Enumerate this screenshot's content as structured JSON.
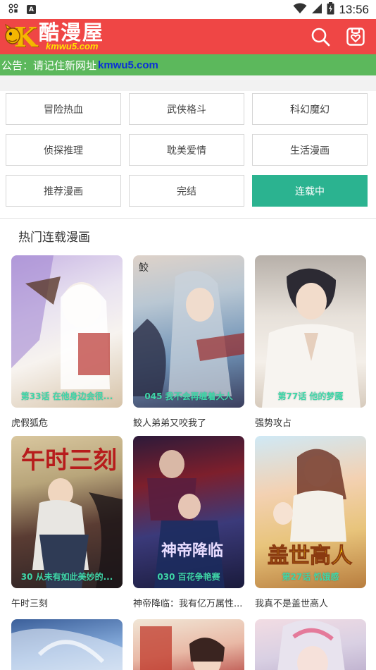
{
  "status_bar": {
    "time": "13:56"
  },
  "header": {
    "logo_mark": "K",
    "logo_text": "酷漫屋",
    "logo_url": "kmwu5.com",
    "search_icon": "search-icon",
    "bookmark_icon": "bookmark-heart-icon"
  },
  "notice": {
    "prefix": "公告：请记住新网址 ",
    "link": "kmwu5.com"
  },
  "categories": [
    {
      "label": "冒险热血",
      "active": false
    },
    {
      "label": "武侠格斗",
      "active": false
    },
    {
      "label": "科幻魔幻",
      "active": false
    },
    {
      "label": "侦探推理",
      "active": false
    },
    {
      "label": "耽美爱情",
      "active": false
    },
    {
      "label": "生活漫画",
      "active": false
    },
    {
      "label": "推荐漫画",
      "active": false
    },
    {
      "label": "完结",
      "active": false
    },
    {
      "label": "连载中",
      "active": true
    }
  ],
  "section": {
    "title": "热门连载漫画",
    "comics": [
      {
        "title": "虎假狐危",
        "episode": "第33话 在他身边会很..."
      },
      {
        "title": "鲛人弟弟又咬我了",
        "episode": "045 我不会再缠着大人"
      },
      {
        "title": "强势攻占",
        "episode": "第77话 他的梦魇"
      },
      {
        "title": "午时三刻",
        "episode": "30 从未有如此美妙的..."
      },
      {
        "title": "神帝降临：我有亿万属性...",
        "episode": "030 百花争艳赛"
      },
      {
        "title": "我真不是盖世高人",
        "episode": "第27话 饥饿感"
      },
      {
        "title": "",
        "episode": ""
      },
      {
        "title": "",
        "episode": ""
      },
      {
        "title": "",
        "episode": ""
      }
    ]
  },
  "colors": {
    "header": "#ef4645",
    "notice": "#5cb85c",
    "accent": "#2bb390",
    "episode_text": "#3fd6a8"
  }
}
